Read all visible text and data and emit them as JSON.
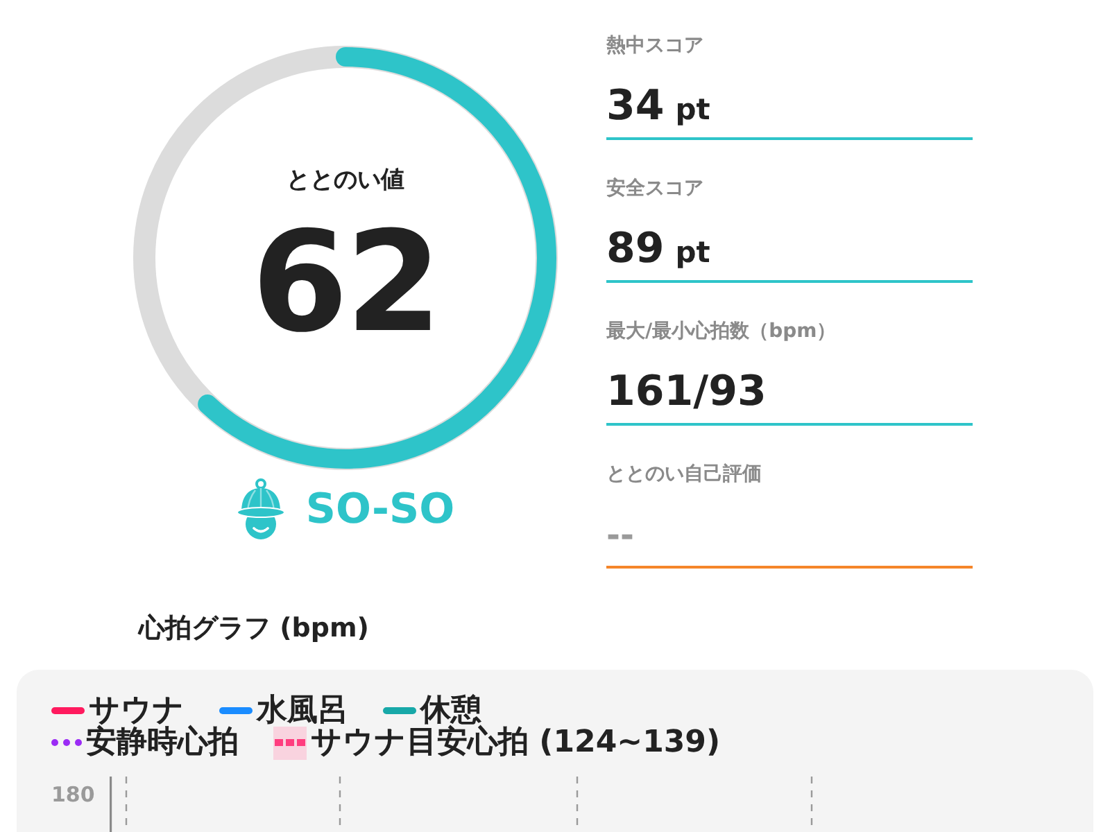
{
  "score": {
    "title": "ととのい値",
    "value": "62",
    "level": 0.62,
    "status": "SO-SO"
  },
  "metrics": [
    {
      "label": "熱中スコア",
      "value": "34",
      "unit": "pt",
      "empty": false,
      "color": "#2ec4c9"
    },
    {
      "label": "安全スコア",
      "value": "89",
      "unit": "pt",
      "empty": false,
      "color": "#2ec4c9"
    },
    {
      "label": "最大/最小心拍数（bpm）",
      "value": "161/93",
      "empty": false,
      "color": "#2ec4c9"
    },
    {
      "label": "ととのい自己評価",
      "value": "--",
      "empty": true,
      "color": "#f5862a"
    }
  ],
  "heart_chart": {
    "title": "心拍グラフ (bpm)",
    "legend_rows": [
      [
        {
          "kind": "line",
          "color": "#ff1a5e",
          "label": "サウナ"
        },
        {
          "kind": "line",
          "color": "#1a8cff",
          "label": "水風呂"
        },
        {
          "kind": "line",
          "color": "#17a8a8",
          "label": "休憩"
        }
      ],
      [
        {
          "kind": "dotted",
          "color": "#9b2cf5",
          "label": "安静時心拍"
        },
        {
          "kind": "band",
          "color": "#ff3d7f",
          "label": "サウナ目安心拍 (124~139)"
        }
      ]
    ],
    "y_tick_labels": [
      "180"
    ]
  }
}
